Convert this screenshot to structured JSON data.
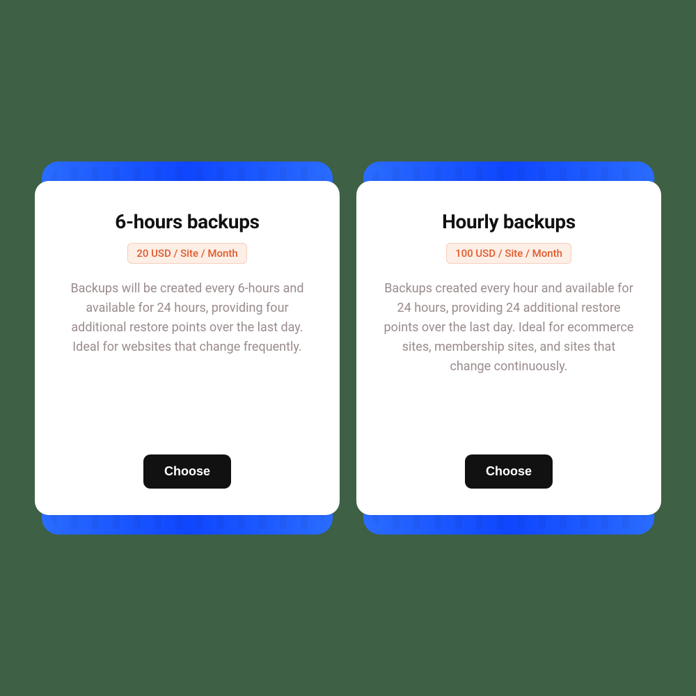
{
  "plans": [
    {
      "title": "6-hours backups",
      "price": "20 USD / Site / Month",
      "description": "Backups will be created every 6-hours and available for 24 hours, providing four additional restore points over the last day. Ideal for websites that change frequently.",
      "button": "Choose"
    },
    {
      "title": "Hourly backups",
      "price": "100 USD / Site / Month",
      "description": "Backups created every hour and available for 24 hours, providing 24 additional restore points over the last day. Ideal for ecommerce sites, membership sites, and sites that change continuously.",
      "button": "Choose"
    }
  ]
}
